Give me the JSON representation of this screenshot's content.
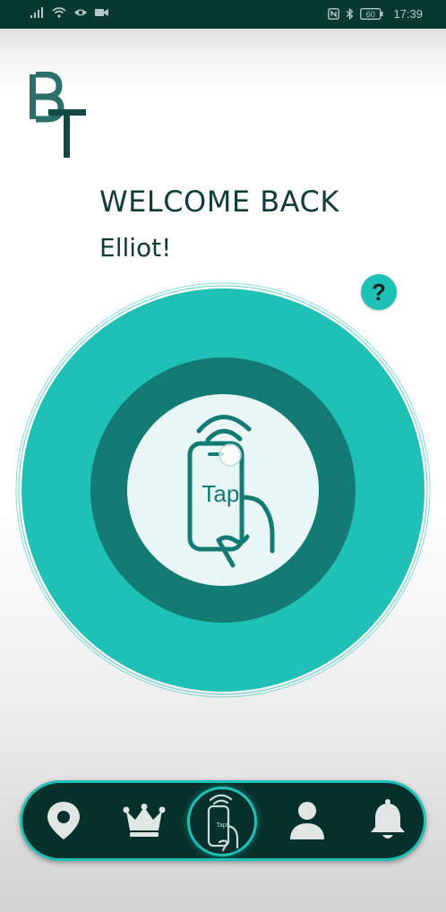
{
  "status_bar": {
    "time": "17:39",
    "battery": "60"
  },
  "logo": {
    "letters": "BT"
  },
  "greeting": {
    "title": "WELCOME BACK",
    "name": "Elliot!"
  },
  "help": {
    "label": "?"
  },
  "tap_button": {
    "label": "Tap!"
  },
  "bottom_nav": {
    "center_label": "Tap!",
    "items": [
      "location",
      "leaderboard",
      "tap",
      "profile",
      "notifications"
    ]
  },
  "colors": {
    "accent": "#1fc1b6",
    "dark_ring": "#137a74",
    "dark_bg": "#06302c",
    "inner_circle": "#e9f6f6"
  }
}
